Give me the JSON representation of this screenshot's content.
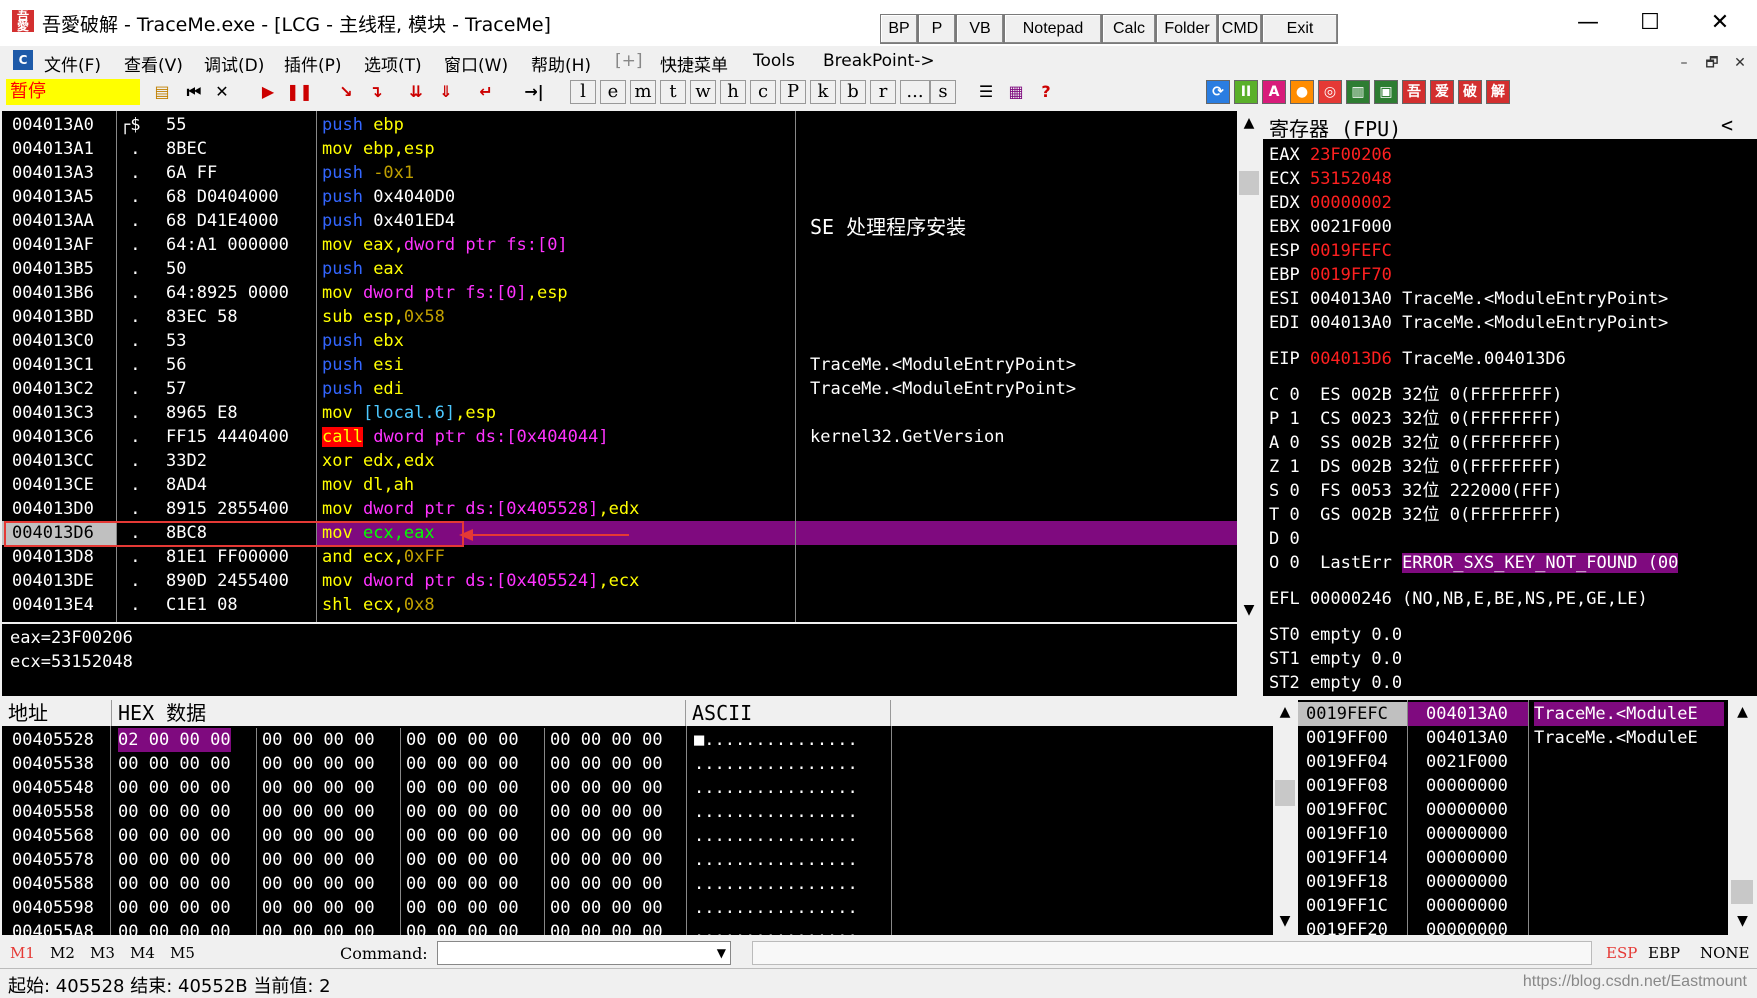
{
  "window": {
    "title": "吾愛破解 - TraceMe.exe - [LCG - 主线程, 模块 - TraceMe]",
    "controls": [
      "—",
      "☐",
      "✕"
    ],
    "app_icon_text": "吾愛"
  },
  "plugin_buttons": [
    "BP",
    "P",
    "VB",
    "Notepad",
    "Calc",
    "Folder",
    "CMD",
    "Exit"
  ],
  "menu": {
    "items": [
      "文件(F)",
      "查看(V)",
      "调试(D)",
      "插件(P)",
      "选项(T)",
      "窗口(W)",
      "帮助(H)",
      "[+]",
      "快捷菜单",
      "Tools",
      "BreakPoint->"
    ],
    "mdi_controls": [
      "–",
      "🗗",
      "✕"
    ]
  },
  "toolbar": {
    "status": "暂停",
    "letter_buttons": [
      "l",
      "e",
      "m",
      "t",
      "w",
      "h",
      "c",
      "P",
      "k",
      "b",
      "r",
      "...",
      "s"
    ],
    "right_icons": [
      "吾",
      "爱",
      "破",
      "解"
    ]
  },
  "disasm": {
    "rows": [
      {
        "addr": "004013A0",
        "mark": "┌$",
        "bytes": "55",
        "parts": [
          [
            "blue",
            "push "
          ],
          [
            "yellow",
            "ebp"
          ]
        ],
        "comment": ""
      },
      {
        "addr": "004013A1",
        "mark": " .",
        "bytes": "8BEC",
        "parts": [
          [
            "yellow",
            "mov "
          ],
          [
            "yellow",
            "ebp,esp"
          ]
        ],
        "comment": ""
      },
      {
        "addr": "004013A3",
        "mark": " .",
        "bytes": "6A FF",
        "parts": [
          [
            "blue",
            "push "
          ],
          [
            "olive",
            "-0x1"
          ]
        ],
        "comment": ""
      },
      {
        "addr": "004013A5",
        "mark": " .",
        "bytes": "68 D0404000",
        "parts": [
          [
            "blue",
            "push "
          ],
          [
            "white",
            "0x4040D0"
          ]
        ],
        "comment": ""
      },
      {
        "addr": "004013AA",
        "mark": " .",
        "bytes": "68 D41E4000",
        "parts": [
          [
            "blue",
            "push "
          ],
          [
            "white",
            "0x401ED4"
          ]
        ],
        "comment": "SE 处理程序安装"
      },
      {
        "addr": "004013AF",
        "mark": " .",
        "bytes": "64:A1 000000",
        "parts": [
          [
            "yellow",
            "mov "
          ],
          [
            "yellow",
            "eax,"
          ],
          [
            "magenta",
            "dword ptr fs:[0]"
          ]
        ],
        "comment": ""
      },
      {
        "addr": "004013B5",
        "mark": " .",
        "bytes": "50",
        "parts": [
          [
            "blue",
            "push "
          ],
          [
            "yellow",
            "eax"
          ]
        ],
        "comment": ""
      },
      {
        "addr": "004013B6",
        "mark": " .",
        "bytes": "64:8925 0000",
        "parts": [
          [
            "yellow",
            "mov "
          ],
          [
            "magenta",
            "dword ptr fs:[0]"
          ],
          [
            "yellow",
            ",esp"
          ]
        ],
        "comment": ""
      },
      {
        "addr": "004013BD",
        "mark": " .",
        "bytes": "83EC 58",
        "parts": [
          [
            "yellow",
            "sub "
          ],
          [
            "yellow",
            "esp,"
          ],
          [
            "olive",
            "0x58"
          ]
        ],
        "comment": ""
      },
      {
        "addr": "004013C0",
        "mark": " .",
        "bytes": "53",
        "parts": [
          [
            "blue",
            "push "
          ],
          [
            "yellow",
            "ebx"
          ]
        ],
        "comment": ""
      },
      {
        "addr": "004013C1",
        "mark": " .",
        "bytes": "56",
        "parts": [
          [
            "blue",
            "push "
          ],
          [
            "yellow",
            "esi"
          ]
        ],
        "comment": "TraceMe.<ModuleEntryPoint>"
      },
      {
        "addr": "004013C2",
        "mark": " .",
        "bytes": "57",
        "parts": [
          [
            "blue",
            "push "
          ],
          [
            "yellow",
            "edi"
          ]
        ],
        "comment": "TraceMe.<ModuleEntryPoint>"
      },
      {
        "addr": "004013C3",
        "mark": " .",
        "bytes": "8965 E8",
        "parts": [
          [
            "yellow",
            "mov "
          ],
          [
            "cyan",
            "[local.6]"
          ],
          [
            "yellow",
            ",esp"
          ]
        ],
        "comment": ""
      },
      {
        "addr": "004013C6",
        "mark": " .",
        "bytes": "FF15 4440400",
        "parts": [
          [
            "call",
            "call"
          ],
          [
            "white",
            " "
          ],
          [
            "magenta",
            "dword ptr ds:[0x404044]"
          ]
        ],
        "comment": "kernel32.GetVersion"
      },
      {
        "addr": "004013CC",
        "mark": " .",
        "bytes": "33D2",
        "parts": [
          [
            "yellow",
            "xor "
          ],
          [
            "yellow",
            "edx,edx"
          ]
        ],
        "comment": ""
      },
      {
        "addr": "004013CE",
        "mark": " .",
        "bytes": "8AD4",
        "parts": [
          [
            "yellow",
            "mov "
          ],
          [
            "yellow",
            "dl,ah"
          ]
        ],
        "comment": ""
      },
      {
        "addr": "004013D0",
        "mark": " .",
        "bytes": "8915 2855400",
        "parts": [
          [
            "yellow",
            "mov "
          ],
          [
            "magenta",
            "dword ptr ds:[0x405528]"
          ],
          [
            "yellow",
            ",edx"
          ]
        ],
        "comment": ""
      },
      {
        "addr": "004013D6",
        "mark": " .",
        "bytes": "8BC8",
        "parts": [
          [
            "yellow",
            "mov "
          ],
          [
            "green",
            "ecx,eax"
          ]
        ],
        "comment": "",
        "current": true
      },
      {
        "addr": "004013D8",
        "mark": " .",
        "bytes": "81E1 FF00000",
        "parts": [
          [
            "yellow",
            "and "
          ],
          [
            "yellow",
            "ecx,"
          ],
          [
            "olive",
            "0xFF"
          ]
        ],
        "comment": ""
      },
      {
        "addr": "004013DE",
        "mark": " .",
        "bytes": "890D 2455400",
        "parts": [
          [
            "yellow",
            "mov "
          ],
          [
            "magenta",
            "dword ptr ds:[0x405524]"
          ],
          [
            "yellow",
            ",ecx"
          ]
        ],
        "comment": ""
      },
      {
        "addr": "004013E4",
        "mark": " .",
        "bytes": "C1E1 08",
        "parts": [
          [
            "yellow",
            "shl "
          ],
          [
            "yellow",
            "ecx,"
          ],
          [
            "olive",
            "0x8"
          ]
        ],
        "comment": ""
      }
    ]
  },
  "info": {
    "lines": [
      "eax=23F00206",
      "ecx=53152048"
    ]
  },
  "registers": {
    "header": "寄存器 (FPU)",
    "collapse": "<",
    "general": [
      {
        "name": "EAX",
        "value": "23F00206",
        "changed": true,
        "note": ""
      },
      {
        "name": "ECX",
        "value": "53152048",
        "changed": true,
        "note": ""
      },
      {
        "name": "EDX",
        "value": "00000002",
        "changed": true,
        "note": ""
      },
      {
        "name": "EBX",
        "value": "0021F000",
        "changed": false,
        "note": ""
      },
      {
        "name": "ESP",
        "value": "0019FEFC",
        "changed": true,
        "note": ""
      },
      {
        "name": "EBP",
        "value": "0019FF70",
        "changed": true,
        "note": ""
      },
      {
        "name": "ESI",
        "value": "004013A0",
        "changed": false,
        "note": "TraceMe.<ModuleEntryPoint>"
      },
      {
        "name": "EDI",
        "value": "004013A0",
        "changed": false,
        "note": "TraceMe.<ModuleEntryPoint>"
      }
    ],
    "eip": {
      "name": "EIP",
      "value": "004013D6",
      "note": "TraceMe.004013D6"
    },
    "flags": [
      "C 0  ES 002B 32位 0(FFFFFFFF)",
      "P 1  CS 0023 32位 0(FFFFFFFF)",
      "A 0  SS 002B 32位 0(FFFFFFFF)",
      "Z 1  DS 002B 32位 0(FFFFFFFF)",
      "S 0  FS 0053 32位 222000(FFF)",
      "T 0  GS 002B 32位 0(FFFFFFFF)",
      "D 0"
    ],
    "lasterr_label": "O 0  LastErr",
    "lasterr_value": "ERROR_SXS_KEY_NOT_FOUND (00",
    "efl": "EFL 00000246 (NO,NB,E,BE,NS,PE,GE,LE)",
    "fpu": [
      "ST0 empty 0.0",
      "ST1 empty 0.0",
      "ST2 empty 0.0"
    ]
  },
  "dump": {
    "headers": [
      "地址",
      "HEX 数据",
      "ASCII"
    ],
    "rows": [
      {
        "addr": "00405528",
        "hex": [
          "02 00 00 00",
          "00 00 00 00",
          "00 00 00 00",
          "00 00 00 00"
        ],
        "ascii": "■..............."
      },
      {
        "addr": "00405538",
        "hex": [
          "00 00 00 00",
          "00 00 00 00",
          "00 00 00 00",
          "00 00 00 00"
        ],
        "ascii": "................"
      },
      {
        "addr": "00405548",
        "hex": [
          "00 00 00 00",
          "00 00 00 00",
          "00 00 00 00",
          "00 00 00 00"
        ],
        "ascii": "................"
      },
      {
        "addr": "00405558",
        "hex": [
          "00 00 00 00",
          "00 00 00 00",
          "00 00 00 00",
          "00 00 00 00"
        ],
        "ascii": "................"
      },
      {
        "addr": "00405568",
        "hex": [
          "00 00 00 00",
          "00 00 00 00",
          "00 00 00 00",
          "00 00 00 00"
        ],
        "ascii": "................"
      },
      {
        "addr": "00405578",
        "hex": [
          "00 00 00 00",
          "00 00 00 00",
          "00 00 00 00",
          "00 00 00 00"
        ],
        "ascii": "................"
      },
      {
        "addr": "00405588",
        "hex": [
          "00 00 00 00",
          "00 00 00 00",
          "00 00 00 00",
          "00 00 00 00"
        ],
        "ascii": "................"
      },
      {
        "addr": "00405598",
        "hex": [
          "00 00 00 00",
          "00 00 00 00",
          "00 00 00 00",
          "00 00 00 00"
        ],
        "ascii": "................"
      },
      {
        "addr": "004055A8",
        "hex": [
          "00 00 00 00",
          "00 00 00 00",
          "00 00 00 00",
          "00 00 00 00"
        ],
        "ascii": "................"
      }
    ]
  },
  "stack": {
    "rows": [
      {
        "addr": "0019FEFC",
        "value": "004013A0",
        "comment": "TraceMe.<ModuleE",
        "current": true
      },
      {
        "addr": "0019FF00",
        "value": "004013A0",
        "comment": "TraceMe.<ModuleE"
      },
      {
        "addr": "0019FF04",
        "value": "0021F000",
        "comment": ""
      },
      {
        "addr": "0019FF08",
        "value": "00000000",
        "comment": ""
      },
      {
        "addr": "0019FF0C",
        "value": "00000000",
        "comment": ""
      },
      {
        "addr": "0019FF10",
        "value": "00000000",
        "comment": ""
      },
      {
        "addr": "0019FF14",
        "value": "00000000",
        "comment": ""
      },
      {
        "addr": "0019FF18",
        "value": "00000000",
        "comment": ""
      },
      {
        "addr": "0019FF1C",
        "value": "00000000",
        "comment": ""
      },
      {
        "addr": "0019FF20",
        "value": "00000000",
        "comment": ""
      }
    ]
  },
  "bottom": {
    "mem_tabs": [
      "M1",
      "M2",
      "M3",
      "M4",
      "M5"
    ],
    "command_label": "Command:",
    "command_value": "",
    "stack_modes": [
      "ESP",
      "EBP",
      "NONE"
    ]
  },
  "statusbar": {
    "text": "起始: 405528 结束: 40552B 当前值: 2",
    "watermark": "https://blog.csdn.net/Eastmount"
  },
  "colors": {
    "accent_red": "#e53935",
    "current_line": "#7f0a7f",
    "status_yellow": "#ffff00"
  }
}
